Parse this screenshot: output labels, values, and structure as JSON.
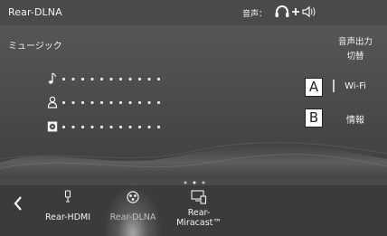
{
  "header": {
    "title": "Rear-DLNA",
    "audio_label": "音声："
  },
  "main": {
    "subtitle": "ミュージック",
    "switch_button": {
      "line1": "音声出力",
      "line2": "切替"
    },
    "rows": [
      {
        "icon": "music-note-icon"
      },
      {
        "icon": "artist-icon"
      },
      {
        "icon": "album-icon"
      }
    ],
    "callouts": [
      "A",
      "B"
    ],
    "side_buttons": {
      "wifi": "Wi-Fi",
      "info": "情報"
    }
  },
  "bottom": {
    "sources": [
      {
        "label": "Rear-HDMI",
        "icon": "hdmi-icon",
        "active": false
      },
      {
        "label": "Rear-DLNA",
        "icon": "dlna-icon",
        "active": true
      },
      {
        "label_line1": "Rear-",
        "label_line2": "Miracast™",
        "icon": "miracast-icon",
        "active": false
      }
    ]
  },
  "colors": {
    "background": "#4b4b4b",
    "text": "#f3f3f3",
    "callout_bg": "#ffffff"
  }
}
